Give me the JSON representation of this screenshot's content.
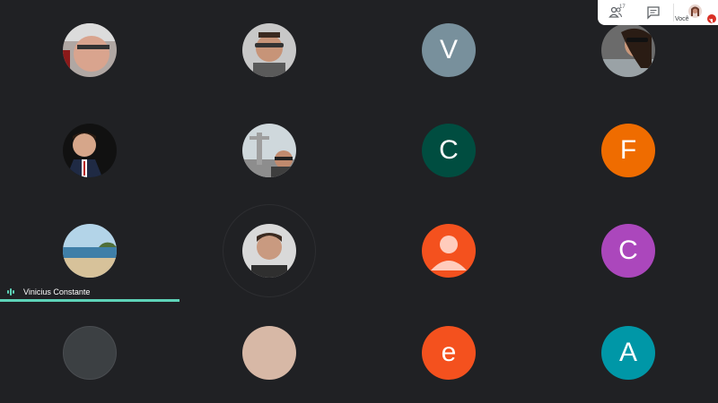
{
  "topbar": {
    "participant_count": "17",
    "self_label": "Você",
    "icons": [
      "people-icon",
      "chat-icon",
      "mic-off-icon"
    ]
  },
  "speaker": {
    "name": "Vinicius Constante"
  },
  "participants": [
    {
      "id": "p1",
      "kind": "photo"
    },
    {
      "id": "p2",
      "kind": "photo"
    },
    {
      "id": "p3",
      "kind": "initial",
      "initial": "V",
      "color": "#78909c"
    },
    {
      "id": "p4",
      "kind": "photo"
    },
    {
      "id": "p5",
      "kind": "photo"
    },
    {
      "id": "p6",
      "kind": "photo"
    },
    {
      "id": "p7",
      "kind": "initial",
      "initial": "C",
      "color": "#004d40"
    },
    {
      "id": "p8",
      "kind": "initial",
      "initial": "F",
      "color": "#ef6c00"
    },
    {
      "id": "p9",
      "kind": "photo"
    },
    {
      "id": "p10",
      "kind": "photo",
      "speaking": true
    },
    {
      "id": "p11",
      "kind": "default-avatar",
      "color": "#f4511e"
    },
    {
      "id": "p12",
      "kind": "initial",
      "initial": "C",
      "color": "#ab47bc"
    },
    {
      "id": "p13",
      "kind": "blank",
      "color": "#3c4043"
    },
    {
      "id": "p14",
      "kind": "blank",
      "color": "#d7b8a6"
    },
    {
      "id": "p15",
      "kind": "initial",
      "initial": "e",
      "color": "#f4511e"
    },
    {
      "id": "p16",
      "kind": "initial",
      "initial": "A",
      "color": "#0097a7"
    }
  ]
}
